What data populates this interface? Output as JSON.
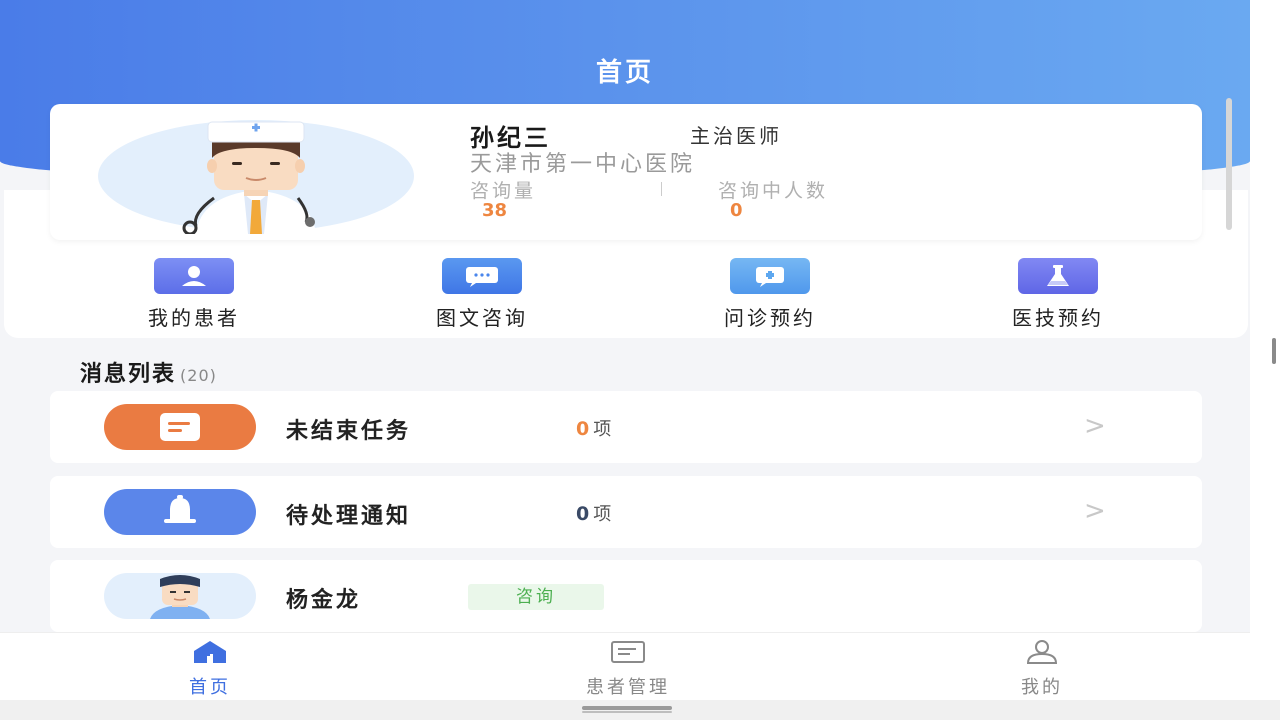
{
  "header": {
    "title": "首页"
  },
  "doctor": {
    "name": "孙纪三",
    "title": "主治医师",
    "hospital": "天津市第一中心医院",
    "stats": [
      {
        "label": "咨询量",
        "value": "38"
      },
      {
        "label": "咨询中人数",
        "value": "0"
      }
    ]
  },
  "quick_actions": [
    {
      "label": "我的患者",
      "icon": "user-icon",
      "color": "#6a7cf0"
    },
    {
      "label": "图文咨询",
      "icon": "chat-icon",
      "color": "#4a86ec"
    },
    {
      "label": "问诊预约",
      "icon": "medical-chat-icon",
      "color": "#5da7ef"
    },
    {
      "label": "医技预约",
      "icon": "flask-icon",
      "color": "#7078f0"
    }
  ],
  "messages": {
    "title": "消息列表",
    "count": "(20)",
    "items": [
      {
        "title": "未结束任务",
        "count": "0",
        "unit": "项",
        "arrow": ">",
        "color": "#ea7b42",
        "icon": "document-icon"
      },
      {
        "title": "待处理通知",
        "count": "0",
        "unit": "项",
        "arrow": ">",
        "color": "#5b86ea",
        "icon": "bell-icon"
      },
      {
        "title": "杨金龙",
        "tag": "咨询",
        "icon": "patient-avatar"
      }
    ]
  },
  "tabbar": [
    {
      "label": "首页",
      "icon": "home-icon",
      "active": true
    },
    {
      "label": "患者管理",
      "icon": "list-icon",
      "active": false
    },
    {
      "label": "我的",
      "icon": "profile-icon",
      "active": false
    }
  ]
}
